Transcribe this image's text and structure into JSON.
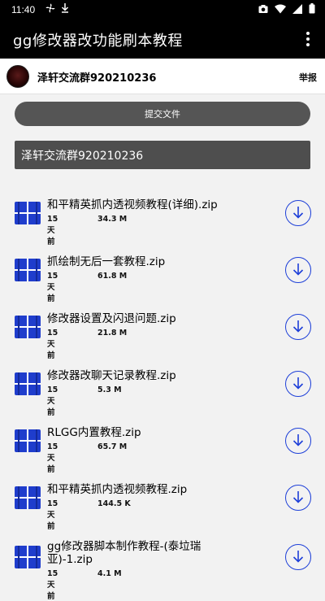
{
  "status_bar": {
    "time": "11:40",
    "left_icons": [
      "fan-icon",
      "download-status-icon"
    ],
    "right_icons": [
      "camera-icon",
      "wifi-icon",
      "signal-icon",
      "battery-icon"
    ]
  },
  "app_bar": {
    "title": "gg修改器改功能刷本教程",
    "menu_icon": "more-vert-icon"
  },
  "group": {
    "name": "泽轩交流群920210236",
    "report_label": "举报"
  },
  "upload_label": "提交文件",
  "banner_text": "泽轩交流群920210236",
  "colors": {
    "download_accent": "#1d3fd8",
    "file_icon": "#1f3dcc",
    "app_bar": "#000000",
    "upload_button": "#555555"
  },
  "files": [
    {
      "name": "和平精英抓内透视频教程(详细).zip",
      "age": "15 天前",
      "size": "34.3 M"
    },
    {
      "name": "抓绘制无后一套教程.zip",
      "age": "15 天前",
      "size": "61.8 M"
    },
    {
      "name": "修改器设置及闪退问题.zip",
      "age": "15 天前",
      "size": "21.8 M"
    },
    {
      "name": "修改器改聊天记录教程.zip",
      "age": "15 天前",
      "size": "5.3 M"
    },
    {
      "name": "RLGG内置教程.zip",
      "age": "15 天前",
      "size": "65.7 M"
    },
    {
      "name": "和平精英抓内透视频教程.zip",
      "age": "15 天前",
      "size": "144.5 K"
    },
    {
      "name": "gg修改器脚本制作教程-(泰垃瑞亚)-1.zip",
      "age": "15 天前",
      "size": "4.1 M"
    }
  ]
}
